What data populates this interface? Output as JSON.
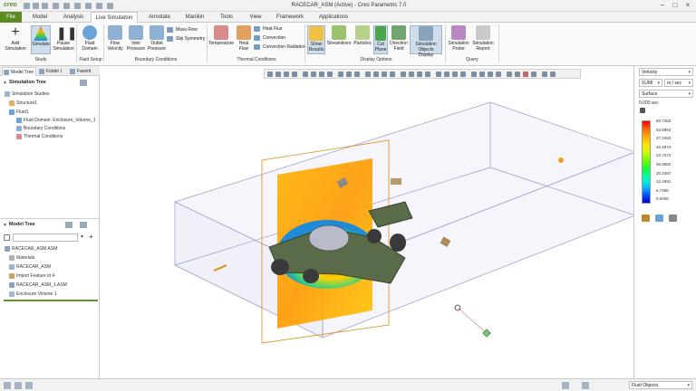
{
  "titlebar": {
    "app_logo": "creo",
    "title": "RACECAR_ASM (Active) - Creo Parametric 7.0"
  },
  "tabs": [
    "File",
    "Model",
    "Analysis",
    "Live Simulation",
    "Annotate",
    "Manikin",
    "Tools",
    "View",
    "Framework",
    "Applications"
  ],
  "ribbon": {
    "buttons": {
      "add_simulation": "Add Simulation",
      "simulate": "Simulate",
      "pause_simulation": "Pause Simulation",
      "fluid_domain": "Fluid Domain",
      "flow_velocity": "Flow Velocity",
      "inlet_pressure": "Inlet Pressure",
      "outlet_pressure": "Outlet Pressure",
      "mass_flow": "Mass Flow",
      "slip_symmetry": "Slip Symmetry",
      "temperature": "Temperature",
      "heat_flow": "Heat Flow",
      "heat_flux": "Heat Flux",
      "convection": "Convection",
      "convection_radiation": "Convection Radiation",
      "show_results": "Show Results",
      "streamlines": "Streamlines",
      "particles": "Particles",
      "cut_plane": "Cut Plane",
      "direction_field": "Direction Field",
      "simulation_objects_display": "Simulation Objects Display",
      "simulation_probe": "Simulation Probe",
      "simulation_report": "Simulation Report"
    },
    "groups": {
      "study": "Study",
      "fluid_setup": "Fluid Setup",
      "boundary_conditions": "Boundary Conditions",
      "thermal_conditions": "Thermal Conditions",
      "display_options": "Display Options",
      "query": "Query"
    }
  },
  "leftpanel": {
    "tabs": [
      "Model Tree",
      "Folder I",
      "Favorit"
    ],
    "simulation_tree": {
      "header": "Simulation Tree",
      "items": [
        "Simulation Studies",
        "Structure1",
        "Fluid1",
        "Fluid Domain: Enclosure_Volume_1",
        "Boundary Conditions",
        "Thermal Conditions"
      ]
    },
    "model_tree": {
      "header": "Model Tree",
      "items": [
        "RACECAR_ASM.ASM",
        "Materials",
        "RACECAR_ASM",
        "Import Feature id 4",
        "RACECAR_ASM_1.ASM",
        "Enclosure Volume 1"
      ]
    }
  },
  "rightpanel": {
    "quantity": "Velocity",
    "unit_system": "SUMI",
    "unit": "m / sec",
    "display": "Surface",
    "time": "0.000 sec",
    "legend": [
      "60.7462",
      "53.9963",
      "47.2463",
      "40.4974",
      "33.7473",
      "26.9982",
      "20.2487",
      "13.4991",
      "6.7496",
      "0.0000"
    ],
    "colors": [
      "#ff0000",
      "#ff6a00",
      "#ffb300",
      "#ffe600",
      "#bfff00",
      "#5cff00",
      "#00ff48",
      "#00ffc0",
      "#00c8ff",
      "#0055ff",
      "#0000cc"
    ]
  },
  "statusbar": {
    "filter": "Fluid Objects"
  }
}
